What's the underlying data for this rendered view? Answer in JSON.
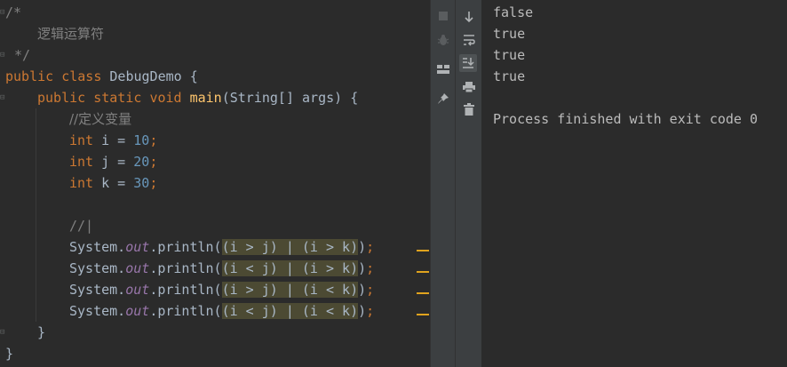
{
  "editor": {
    "comment_open": "/*",
    "comment_text": "逻辑运算符",
    "comment_close": "*/",
    "class_kw1": "public",
    "class_kw2": "class",
    "class_name": "DebugDemo",
    "brace_open": " {",
    "method_kw1": "public",
    "method_kw2": "static",
    "method_kw3": "void",
    "method_name": "main",
    "method_params": "(String[] args) {",
    "var_comment": "//定义变量",
    "vars": [
      {
        "type": "int",
        "name": " i = ",
        "value": "10",
        "end": ";"
      },
      {
        "type": "int",
        "name": " j = ",
        "value": "20",
        "end": ";"
      },
      {
        "type": "int",
        "name": " k = ",
        "value": "30",
        "end": ";"
      }
    ],
    "cursor_comment": "//|",
    "prints": [
      {
        "prefix": "System.",
        "field": "out",
        "call": ".println(",
        "expr": "(i > j) | (i > k)",
        "close": ")",
        "semi": ";"
      },
      {
        "prefix": "System.",
        "field": "out",
        "call": ".println(",
        "expr": "(i < j) | (i > k)",
        "close": ")",
        "semi": ";"
      },
      {
        "prefix": "System.",
        "field": "out",
        "call": ".println(",
        "expr": "(i > j) | (i < k)",
        "close": ")",
        "semi": ";"
      },
      {
        "prefix": "System.",
        "field": "out",
        "call": ".println(",
        "expr": "(i < j) | (i < k)",
        "close": ")",
        "semi": ";"
      }
    ],
    "close_method": "}",
    "close_class": "}"
  },
  "console": {
    "lines": [
      "false",
      "true",
      "true",
      "true"
    ],
    "exit_message": "Process finished with exit code 0"
  },
  "toolbar": {
    "left_icons": [
      "stop-icon",
      "bug-icon",
      "layout-icon",
      "pin-icon"
    ],
    "right_icons": [
      "scroll-down-icon",
      "soft-wrap-icon",
      "scroll-to-end-icon",
      "print-icon",
      "trash-icon"
    ],
    "active": "scroll-to-end-icon"
  },
  "colors": {
    "background": "#2b2b2b",
    "keyword": "#cc7832",
    "method": "#ffc66d",
    "number": "#6897bb",
    "field": "#9876aa",
    "comment": "#808080",
    "highlight": "#4c4a33",
    "marker": "#e0a31e"
  }
}
